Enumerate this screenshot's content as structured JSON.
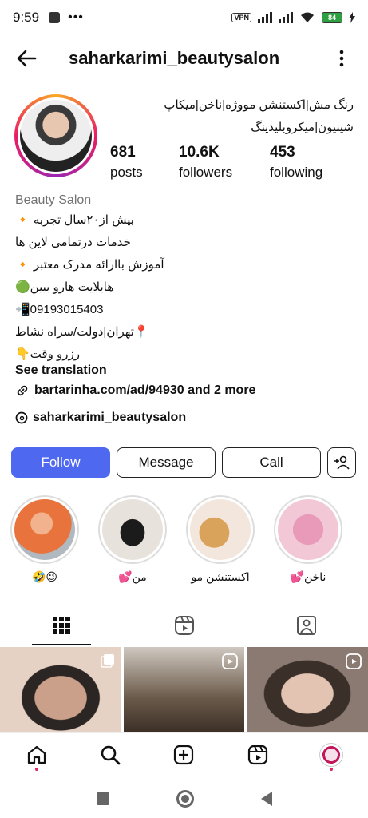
{
  "status_bar": {
    "time": "9:59",
    "vpn_label": "VPN",
    "battery": "84"
  },
  "header": {
    "username": "saharkarimi_beautysalon"
  },
  "profile": {
    "bio_top_line1": "رنگ مش|اکستنشن مووژه|ناخن|میکاپ",
    "bio_top_line2": "شینیون|میکروبلیدینگ",
    "stats": [
      {
        "value": "681",
        "label": "posts"
      },
      {
        "value": "10.6K",
        "label": "followers"
      },
      {
        "value": "453",
        "label": "following"
      }
    ],
    "category": "Beauty Salon",
    "bio_lines": [
      "بیش از۲۰سال تجربه 🔸",
      "خدمات درتمامی لاین ها",
      "آموزش باارائه مدرک معتبر 🔸",
      "هایلایت هارو ببین🟢",
      "📲09193015403",
      "📍تهران|دولت/سراه نشاط",
      "رزرو وقت👇"
    ],
    "see_translation": "See translation",
    "link_text": "bartarinha.com/ad/94930 and 2 more",
    "threads_text": "saharkarimi_beautysalon"
  },
  "buttons": {
    "follow": "Follow",
    "message": "Message",
    "call": "Call"
  },
  "highlights": [
    {
      "label": "😉🤣",
      "color": "#e8733c"
    },
    {
      "label": "من💕",
      "color": "#e8e2dc"
    },
    {
      "label": "اکستنشن مو",
      "color": "#f3e6dc"
    },
    {
      "label": "ناخن💕",
      "color": "#f2c7d6"
    }
  ],
  "tabs": [
    "grid-icon",
    "reels-icon",
    "tagged-icon"
  ],
  "bottom_nav": [
    "home-icon",
    "search-icon",
    "create-icon",
    "reels-icon",
    "profile-icon"
  ],
  "colors": {
    "follow_button": "#4f68f0",
    "story_ring": "#e91e63"
  }
}
